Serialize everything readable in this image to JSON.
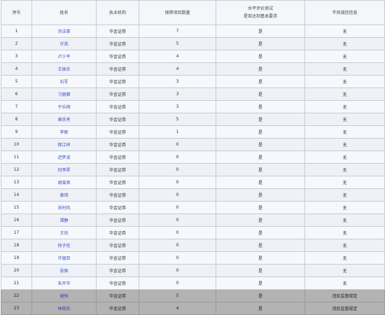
{
  "headers": {
    "no": "序号",
    "name": "姓名",
    "org": "执业机构",
    "count": "保荐项目数量",
    "review_line1": "水平评价测试",
    "review_line2": "是否达到基本要求",
    "record": "不良诚信信息"
  },
  "rows": [
    {
      "no": "1",
      "name": "刘洁辜",
      "org": "华金证券",
      "count": "7",
      "pass": "是",
      "record": "无"
    },
    {
      "no": "2",
      "name": "许英",
      "org": "华金证券",
      "count": "5",
      "pass": "是",
      "record": "无"
    },
    {
      "no": "3",
      "name": "卢少平",
      "org": "华金证券",
      "count": "4",
      "pass": "是",
      "record": "无"
    },
    {
      "no": "4",
      "name": "王振东",
      "org": "华金证券",
      "count": "4",
      "pass": "是",
      "record": "无"
    },
    {
      "no": "5",
      "name": "石军",
      "org": "华金证券",
      "count": "3",
      "pass": "是",
      "record": "无"
    },
    {
      "no": "6",
      "name": "习丽卿",
      "org": "华金证券",
      "count": "3",
      "pass": "是",
      "record": "无"
    },
    {
      "no": "7",
      "name": "于乐翔",
      "org": "华金证券",
      "count": "3",
      "pass": "是",
      "record": "无"
    },
    {
      "no": "8",
      "name": "章庆考",
      "org": "华金证券",
      "count": "5",
      "pass": "是",
      "record": "无"
    },
    {
      "no": "9",
      "name": "李刚",
      "org": "华金证券",
      "count": "1",
      "pass": "是",
      "record": "无"
    },
    {
      "no": "10",
      "name": "邢江祥",
      "org": "华金证券",
      "count": "0",
      "pass": "是",
      "record": "无"
    },
    {
      "no": "11",
      "name": "迟梦凌",
      "org": "华金证券",
      "count": "0",
      "pass": "是",
      "record": "无"
    },
    {
      "no": "12",
      "name": "何李昇",
      "org": "华金证券",
      "count": "0",
      "pass": "是",
      "record": "无"
    },
    {
      "no": "13",
      "name": "胡寅宾",
      "org": "华金证券",
      "count": "0",
      "pass": "是",
      "record": "无"
    },
    {
      "no": "14",
      "name": "黄琪",
      "org": "华金证券",
      "count": "0",
      "pass": "是",
      "record": "无"
    },
    {
      "no": "15",
      "name": "宋时风",
      "org": "华金证券",
      "count": "0",
      "pass": "是",
      "record": "无"
    },
    {
      "no": "16",
      "name": "谭静",
      "org": "华金证券",
      "count": "0",
      "pass": "是",
      "record": "无"
    },
    {
      "no": "17",
      "name": "王良",
      "org": "华金证券",
      "count": "0",
      "pass": "是",
      "record": "无"
    },
    {
      "no": "18",
      "name": "徐子伦",
      "org": "华金证券",
      "count": "0",
      "pass": "是",
      "record": "无"
    },
    {
      "no": "19",
      "name": "许银亚",
      "org": "华金证券",
      "count": "0",
      "pass": "是",
      "record": "无"
    },
    {
      "no": "20",
      "name": "张佩",
      "org": "华金证券",
      "count": "0",
      "pass": "是",
      "record": "无"
    },
    {
      "no": "21",
      "name": "朱开华",
      "org": "华金证券",
      "count": "0",
      "pass": "是",
      "record": "无"
    },
    {
      "no": "22",
      "name": "谢恒",
      "org": "华金证券",
      "count": "5",
      "pass": "是",
      "record": "违反监管规定",
      "flagged": true
    },
    {
      "no": "23",
      "name": "林晓东",
      "org": "华金证券",
      "count": "4",
      "pass": "是",
      "record": "违反监管规定",
      "flagged": true
    }
  ]
}
